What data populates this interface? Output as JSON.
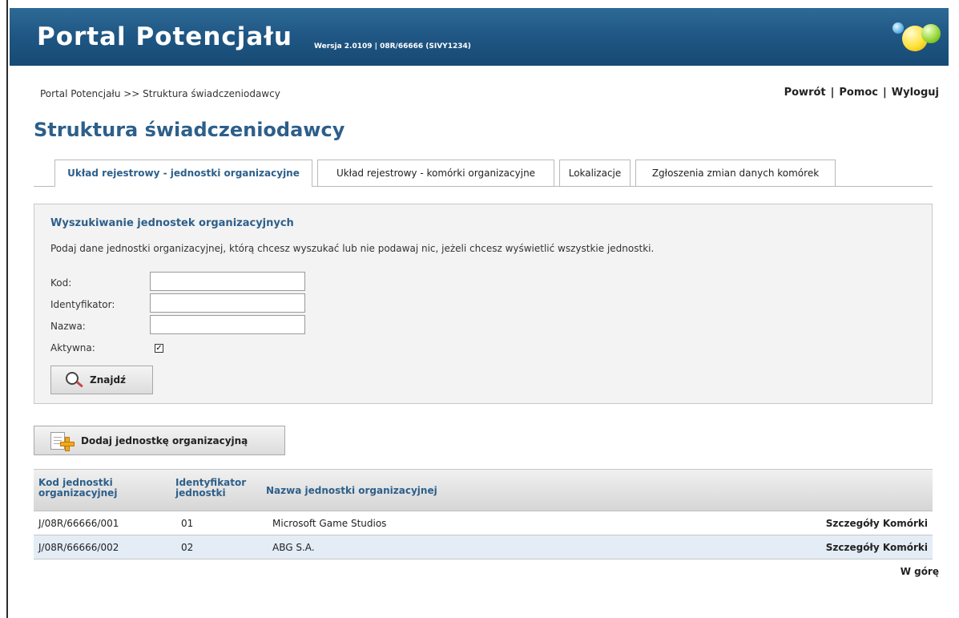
{
  "app": {
    "title": "Portal Potencjału",
    "version": "Wersja 2.0109 | 08R/66666 (SIVY1234)"
  },
  "breadcrumb": "Portal Potencjału >> Struktura świadczeniodawcy",
  "toplinks": {
    "back": "Powrót",
    "help": "Pomoc",
    "logout": "Wyloguj",
    "separator": "|"
  },
  "page_title": "Struktura świadczeniodawcy",
  "tabs": [
    {
      "label": "Układ rejestrowy - jednostki organizacyjne",
      "active": true
    },
    {
      "label": "Układ rejestrowy - komórki organizacyjne",
      "active": false
    },
    {
      "label": "Lokalizacje",
      "active": false
    },
    {
      "label": "Zgłoszenia zmian danych komórek",
      "active": false
    }
  ],
  "search": {
    "title": "Wyszukiwanie jednostek organizacyjnych",
    "description": "Podaj dane jednostki organizacyjnej, którą chcesz wyszukać lub nie podawaj nic, jeżeli chcesz wyświetlić wszystkie jednostki.",
    "fields": {
      "kod": {
        "label": "Kod:",
        "value": ""
      },
      "identyfikator": {
        "label": "Identyfikator:",
        "value": ""
      },
      "nazwa": {
        "label": "Nazwa:",
        "value": ""
      },
      "aktywna": {
        "label": "Aktywna:",
        "checked": true,
        "mark": "✓"
      }
    },
    "find_button": "Znajdź",
    "find_icon": "magnifier-icon"
  },
  "add_button": {
    "label": "Dodaj jednostkę organizacyjną",
    "icon": "add-document-icon"
  },
  "table": {
    "columns": {
      "code": "Kod jednostki organizacyjnej",
      "identifier": "Identyfikator jednostki",
      "name": "Nazwa jednostki organizacyjnej"
    },
    "rows": [
      {
        "code": "J/08R/66666/001",
        "identifier": "01",
        "name": "Microsoft Game Studios",
        "details": "Szczegóły",
        "cells": "Komórki"
      },
      {
        "code": "J/08R/66666/002",
        "identifier": "02",
        "name": "ABG S.A.",
        "details": "Szczegóły",
        "cells": "Komórki"
      }
    ]
  },
  "back_to_top": "W górę",
  "colors": {
    "banner": "#1f5683",
    "accent": "#2d5f8a",
    "row_alt": "#e4ecf6"
  }
}
